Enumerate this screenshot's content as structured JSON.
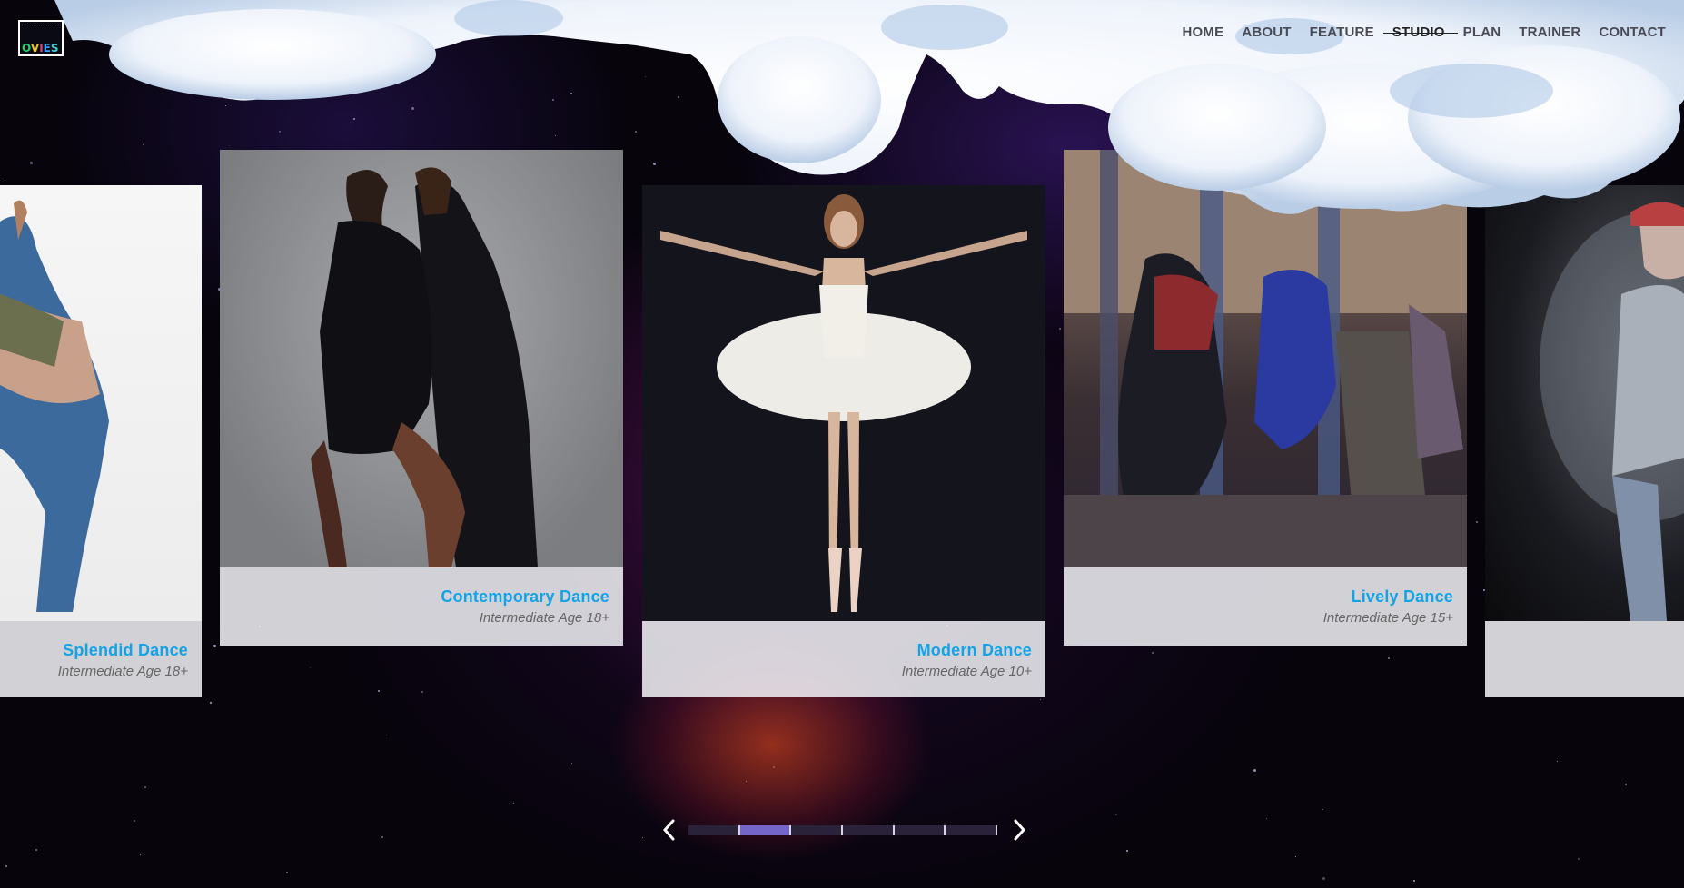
{
  "brand": {
    "logo_text": [
      "O",
      "V",
      "I",
      "E",
      "S"
    ]
  },
  "nav": {
    "items": [
      "HOME",
      "ABOUT",
      "FEATURE",
      "STUDIO",
      "PLAN",
      "TRAINER",
      "CONTACT"
    ],
    "active": "STUDIO"
  },
  "cards": [
    {
      "title": "Splendid Dance",
      "level": "Intermediate Age 18+"
    },
    {
      "title": "Contemporary Dance",
      "level": "Intermediate Age 18+"
    },
    {
      "title": "Modern Dance",
      "level": "Intermediate Age 10+"
    },
    {
      "title": "Lively Dance",
      "level": "Intermediate Age 15+"
    },
    {
      "title": "",
      "level": ""
    }
  ],
  "slider": {
    "segments": 6,
    "active_index": 1
  },
  "colors": {
    "accent_title": "#13a3e6",
    "slider_active": "#7466c8",
    "caption_bg": "#eeeef2"
  }
}
